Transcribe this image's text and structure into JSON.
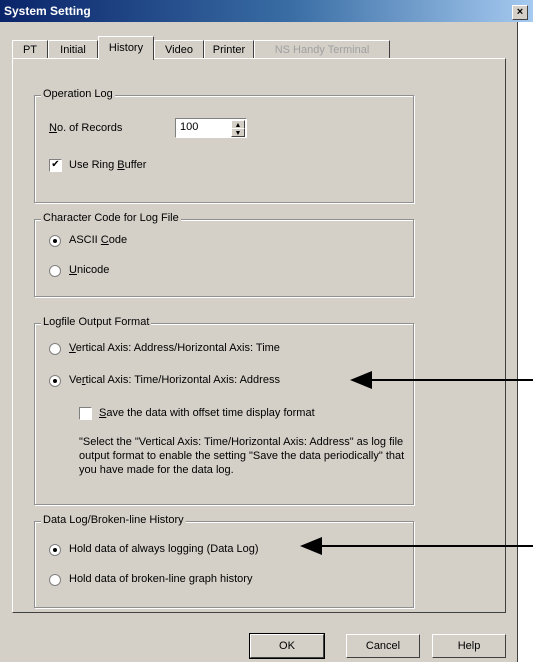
{
  "window": {
    "title": "System Setting",
    "close": "×"
  },
  "tabs": [
    {
      "label": "PT",
      "state": "normal"
    },
    {
      "label": "Initial",
      "state": "normal"
    },
    {
      "label": "History",
      "state": "active"
    },
    {
      "label": "Video",
      "state": "normal"
    },
    {
      "label": "Printer",
      "state": "normal"
    },
    {
      "label": "NS Handy Terminal",
      "state": "disabled"
    }
  ],
  "operation_log": {
    "title": "Operation Log",
    "records_label_ul": "N",
    "records_label_rest": "o. of Records",
    "records_value": "100",
    "ring_buffer_checked": "✔",
    "ring_buffer_label": "Use Ring Buffer",
    "ring_buffer_ul": "B",
    "ring_buffer_pre": "Use Ring ",
    "ring_buffer_post": "uffer"
  },
  "char_code": {
    "title": "Character Code for Log File",
    "ascii": {
      "pre": "ASCII ",
      "ul": "C",
      "post": "ode",
      "selected": true
    },
    "unicode": {
      "pre": "",
      "ul": "U",
      "post": "nicode",
      "selected": false
    }
  },
  "output_format": {
    "title": "Logfile Output Format",
    "opt1": {
      "pre": "",
      "ul": "V",
      "post": "ertical Axis: Address/Horizontal Axis: Time",
      "selected": false
    },
    "opt2": {
      "pre": "Ve",
      "ul": "r",
      "post": "tical Axis: Time/Horizontal Axis: Address",
      "selected": true
    },
    "offset": {
      "pre": "",
      "ul": "S",
      "post": "ave the data with offset time display format",
      "checked": false
    },
    "note": "\"Select the \"Vertical Axis: Time/Horizontal Axis: Address\" as log file output format to enable the setting \"Save the data periodically\" that you have made for the data log."
  },
  "data_log": {
    "title": "Data Log/Broken-line History",
    "opt1": {
      "label": "Hold data of always logging (Data Log)",
      "selected": true
    },
    "opt2": {
      "label": "Hold data of broken-line graph history",
      "selected": false
    }
  },
  "buttons": {
    "ok": "OK",
    "cancel": "Cancel",
    "help": "Help"
  }
}
